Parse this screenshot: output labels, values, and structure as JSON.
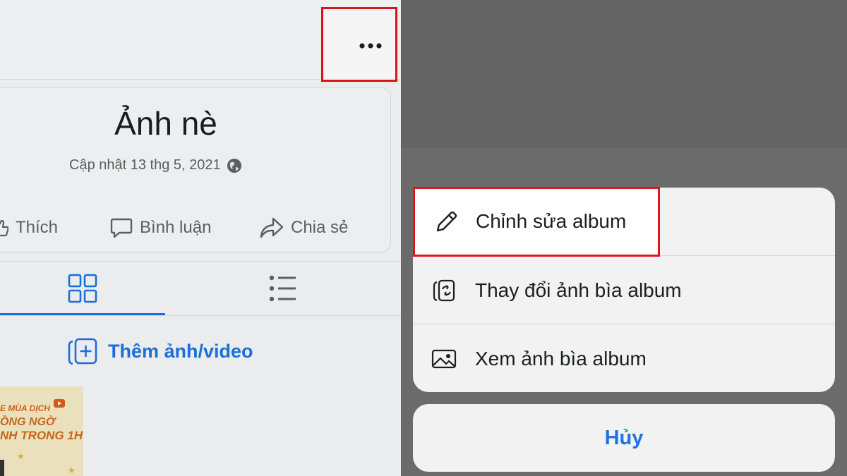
{
  "album": {
    "title": "Ảnh nè",
    "updated": "Cập nhật 13 thg 5, 2021"
  },
  "actions": {
    "like": "Thích",
    "comment": "Bình luận",
    "share": "Chia sẻ"
  },
  "tabs": [
    {
      "icon": "grid-icon",
      "active": true
    },
    {
      "icon": "list-icon",
      "active": false
    }
  ],
  "add_media_label": "Thêm ảnh/video",
  "thumbnail": {
    "line1": "E MÙA DỊCH",
    "line2": "ỒNG NGỜ",
    "line3": "NH TRONG 1H"
  },
  "menu": {
    "items": [
      {
        "label": "Chỉnh sửa album",
        "icon": "pencil-icon",
        "highlighted": true
      },
      {
        "label": "Thay đổi ảnh bìa album",
        "icon": "change-cover-icon",
        "highlighted": false
      },
      {
        "label": "Xem ảnh bìa album",
        "icon": "image-icon",
        "highlighted": false
      }
    ],
    "cancel_label": "Hủy"
  },
  "colors": {
    "accent": "#1b74e4",
    "highlight_border": "#e3141b",
    "overlay": "#646464",
    "sheet": "#f2f2f2"
  }
}
